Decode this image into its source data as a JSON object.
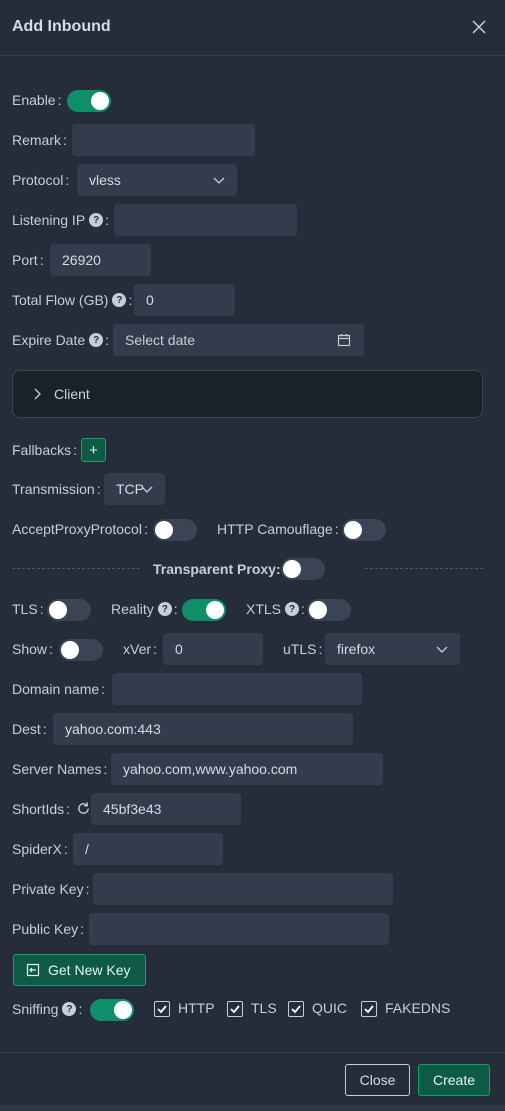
{
  "modal": {
    "title": "Add Inbound"
  },
  "form": {
    "enable": {
      "label": "Enable",
      "on": true
    },
    "remark": {
      "label": "Remark",
      "value": ""
    },
    "protocol": {
      "label": "Protocol",
      "value": "vless"
    },
    "listening_ip": {
      "label": "Listening IP",
      "value": ""
    },
    "port": {
      "label": "Port",
      "value": "26920"
    },
    "total_flow": {
      "label": "Total Flow (GB)",
      "value": "0"
    },
    "expire_date": {
      "label": "Expire Date",
      "placeholder": "Select date"
    },
    "client": {
      "label": "Client"
    },
    "fallbacks": {
      "label": "Fallbacks",
      "add": "+"
    },
    "transmission": {
      "label": "Transmission",
      "value": "TCP"
    },
    "accept_proxy_protocol": {
      "label": "AcceptProxyProtocol",
      "on": false
    },
    "http_camouflage": {
      "label": "HTTP Camouflage",
      "on": false
    },
    "transparent_proxy": {
      "label": "Transparent Proxy",
      "on": false
    },
    "tls": {
      "label": "TLS",
      "on": false
    },
    "reality": {
      "label": "Reality",
      "on": true
    },
    "xtls": {
      "label": "XTLS",
      "on": false
    },
    "show": {
      "label": "Show",
      "on": false
    },
    "xver": {
      "label": "xVer",
      "value": "0"
    },
    "utls": {
      "label": "uTLS",
      "value": "firefox"
    },
    "domain_name": {
      "label": "Domain name",
      "value": ""
    },
    "dest": {
      "label": "Dest",
      "value": "yahoo.com:443"
    },
    "server_names": {
      "label": "Server Names",
      "value": "yahoo.com,www.yahoo.com"
    },
    "short_ids": {
      "label": "ShortIds",
      "value": "45bf3e43"
    },
    "spider_x": {
      "label": "SpiderX",
      "value": "/"
    },
    "private_key": {
      "label": "Private Key",
      "value": ""
    },
    "public_key": {
      "label": "Public Key",
      "value": ""
    },
    "get_new_key": {
      "label": "Get New Key"
    },
    "sniffing": {
      "label": "Sniffing",
      "on": true,
      "options": [
        {
          "label": "HTTP",
          "checked": true
        },
        {
          "label": "TLS",
          "checked": true
        },
        {
          "label": "QUIC",
          "checked": true
        },
        {
          "label": "FAKEDNS",
          "checked": true
        }
      ]
    }
  },
  "footer": {
    "close": "Close",
    "create": "Create"
  },
  "colors": {
    "accent": "#0e8f6a",
    "background": "#252d3a",
    "input": "#323c4c"
  },
  "icons": [
    "close-icon",
    "question-icon",
    "chevron-down-icon",
    "calendar-icon",
    "chevron-right-icon",
    "refresh-icon",
    "key-icon",
    "check-icon"
  ]
}
